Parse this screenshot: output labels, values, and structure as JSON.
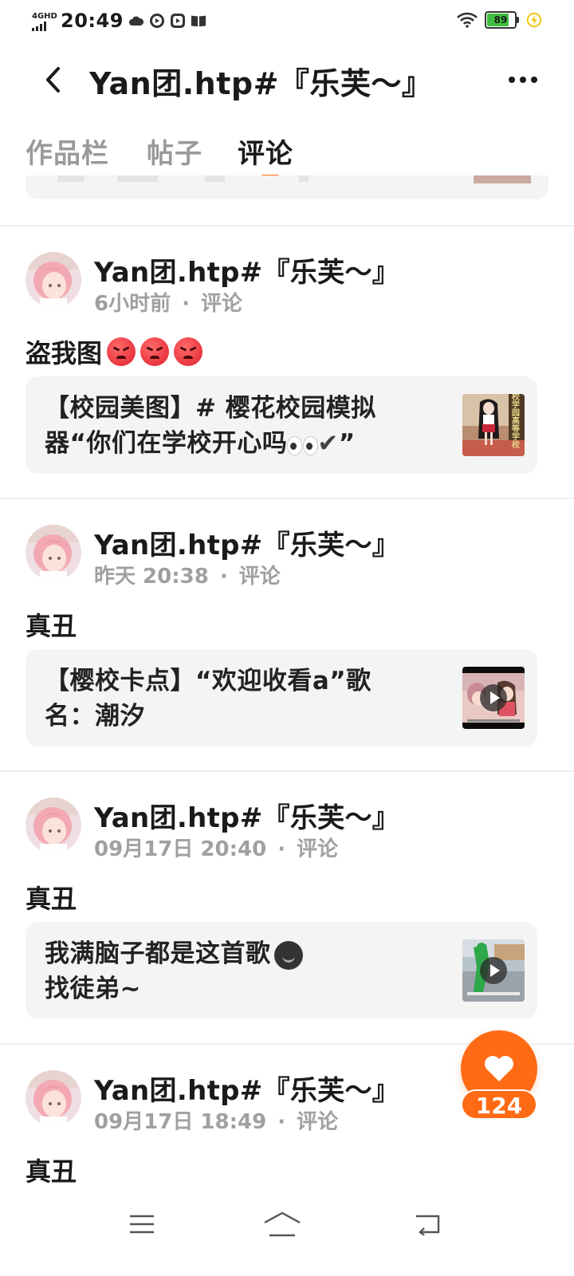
{
  "status_bar": {
    "network": "4GHD",
    "time": "20:49",
    "battery": "89",
    "icons": [
      "cloud-icon",
      "media-icon",
      "media-icon",
      "book-icon",
      "wifi-icon",
      "battery-icon",
      "charging-icon"
    ]
  },
  "header": {
    "title": "Yan团.htp#『乐芙～』"
  },
  "tabs": [
    {
      "label": "作品栏",
      "active": false
    },
    {
      "label": "帖子",
      "active": false
    },
    {
      "label": "评论",
      "active": true
    }
  ],
  "items": [
    {
      "author": "Yan团.htp#『乐芙～』",
      "time": "6小时前",
      "type": "评论",
      "comment": "盗我图",
      "card_text": "【校园美图】# 樱花校园模拟器“你们在学校开心吗👀✔”",
      "card_line1": "【校园美图】# 樱花校园模拟",
      "card_line2": "器“你们在学校开心吗",
      "card_line2_tail": "”",
      "thumb_text": "校学园高等学校",
      "has_video": false
    },
    {
      "author": "Yan团.htp#『乐芙～』",
      "time": "昨天 20:38",
      "type": "评论",
      "comment": "真丑",
      "card_line1": "【樱校卡点】“欢迎收看a”歌",
      "card_line2": "名：潮汐",
      "has_video": true
    },
    {
      "author": "Yan团.htp#『乐芙～』",
      "time": "09月17日 20:40",
      "type": "评论",
      "comment": "真丑",
      "card_line1": "我满脑子都是这首歌",
      "card_line2": "找徒弟~",
      "has_video": true
    },
    {
      "author": "Yan团.htp#『乐芙～』",
      "time": "09月17日 18:49",
      "type": "评论",
      "comment": "真丑"
    }
  ],
  "like": {
    "count": "124"
  },
  "colors": {
    "accent": "#ff6a14",
    "card_bg": "#f4f4f4",
    "meta_text": "#a0a0a0"
  }
}
